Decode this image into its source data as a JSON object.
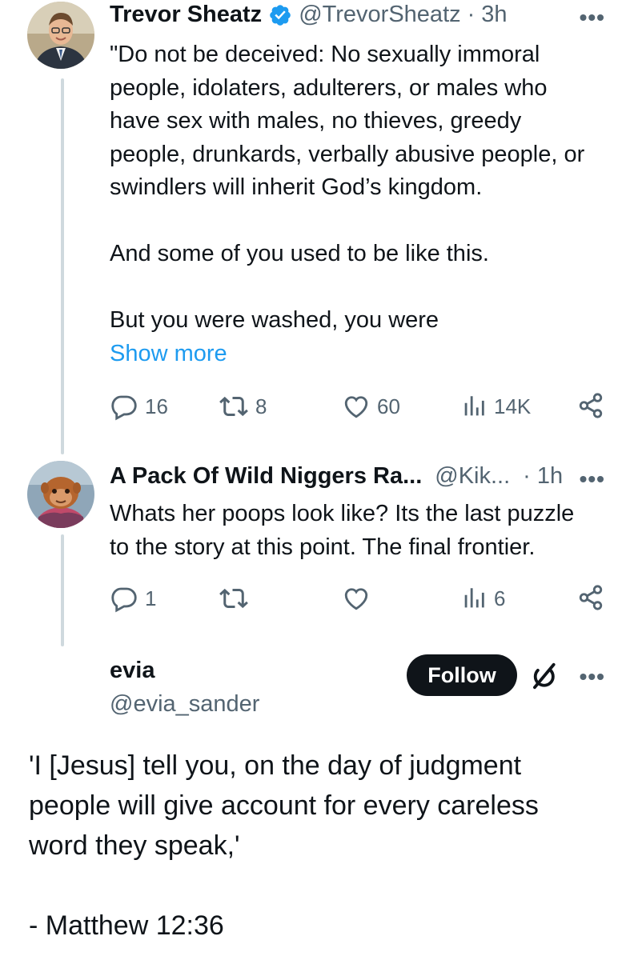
{
  "tweet1": {
    "name": "Trevor Sheatz",
    "handle": "@TrevorSheatz",
    "time": "3h",
    "more": "•••",
    "text_lines": "\"Do not be deceived: No sexually immoral\npeople, idolaters, adulterers, or males who\nhave sex with males, no thieves, greedy\npeople, drunkards, verbally abusive people, or\nswindlers will inherit God’s kingdom.\n\nAnd some of you used to be like this.\n\nBut you were washed, you were",
    "show_more": "Show more",
    "replies": "16",
    "retweets": "8",
    "likes": "60",
    "views": "14K"
  },
  "tweet2": {
    "name": "A Pack Of Wild Niggers Ra...",
    "handle": "@Kik...",
    "time": "1h",
    "more": "•••",
    "text": "Whats her poops look like? Its the last puzzle\nto the story at this point. The final frontier.",
    "replies": "1",
    "views": "6"
  },
  "tweet3": {
    "name": "evia",
    "handle": "@evia_sander",
    "follow_label": "Follow",
    "more": "•••",
    "text": "'I [Jesus] tell you, on the day of judgment\npeople will give account for every careless\nword they speak,'\n\n- Matthew 12:36"
  },
  "colors": {
    "text": "#0f1419",
    "muted": "#536471",
    "link": "#1d9bf0",
    "verified": "#1d9bf0",
    "thread_line": "#cfd9de"
  },
  "icons": [
    "reply-icon",
    "retweet-icon",
    "like-icon",
    "views-icon",
    "share-icon",
    "verified-icon",
    "grok-icon",
    "more-icon"
  ]
}
